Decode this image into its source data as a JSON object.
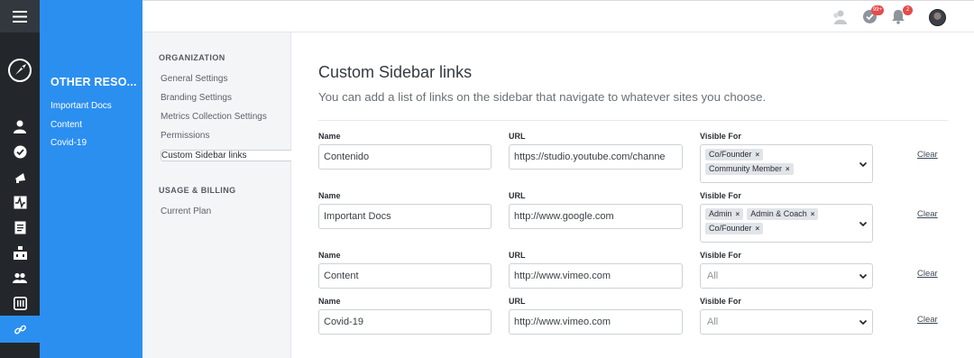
{
  "sidebar_panel": {
    "title": "OTHER RESO...",
    "links": [
      "Important Docs",
      "Content",
      "Covid-19"
    ]
  },
  "topbar": {
    "badges": {
      "tasks": "99+",
      "notifications": "2"
    }
  },
  "settings_nav": {
    "organization_heading": "ORGANIZATION",
    "organization_items": [
      "General Settings",
      "Branding Settings",
      "Metrics Collection Settings",
      "Permissions",
      "Custom Sidebar links"
    ],
    "billing_heading": "USAGE & BILLING",
    "billing_items": [
      "Current Plan"
    ]
  },
  "page": {
    "title": "Custom Sidebar links",
    "description": "You can add a list of links on the sidebar that navigate to whatever sites you choose."
  },
  "labels": {
    "name": "Name",
    "url": "URL",
    "visible_for": "Visible For",
    "clear": "Clear",
    "all_placeholder": "All"
  },
  "rows": [
    {
      "name": "Contenido",
      "url": "https://studio.youtube.com/channe",
      "visible_for": [
        "Co/Founder",
        "Community Member"
      ]
    },
    {
      "name": "Important Docs",
      "url": "http://www.google.com",
      "visible_for": [
        "Admin",
        "Admin & Coach",
        "Co/Founder"
      ]
    },
    {
      "name": "Content",
      "url": "http://www.vimeo.com",
      "visible_for": []
    },
    {
      "name": "Covid-19",
      "url": "http://www.vimeo.com",
      "visible_for": []
    }
  ],
  "colors": {
    "accent": "#2b8ff0",
    "rail": "#23272b"
  }
}
